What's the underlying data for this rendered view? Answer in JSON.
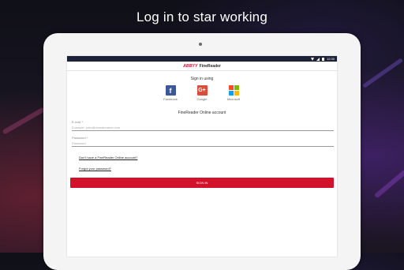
{
  "headline": "Log in to star working",
  "status_bar": {
    "time": "12:30"
  },
  "app_bar": {
    "brand_mark": "ABBYY",
    "brand_name": "FineReader"
  },
  "sign_in": {
    "title": "Sign in using",
    "providers": [
      {
        "label": "Facebook",
        "icon": "facebook-icon",
        "glyph": "f",
        "color": "#3b5998"
      },
      {
        "label": "Google",
        "icon": "google-plus-icon",
        "glyph": "G+",
        "color": "#dd4b39"
      },
      {
        "label": "Microsoft",
        "icon": "microsoft-icon",
        "colors": [
          "#f25022",
          "#7fba00",
          "#00a4ef",
          "#ffb900"
        ]
      }
    ]
  },
  "account": {
    "title": "FineReader Online account",
    "email_label": "E-mail *",
    "email_placeholder": "Example: john@domainname.com",
    "password_label": "Password *",
    "password_placeholder": "Password",
    "no_account_link": "Don't have a FineReader Online account?",
    "forgot_link": "Forgot your password?",
    "signin_button": "SIGN IN"
  },
  "colors": {
    "accent": "#d1122a",
    "status_bar": "#1e2238"
  }
}
